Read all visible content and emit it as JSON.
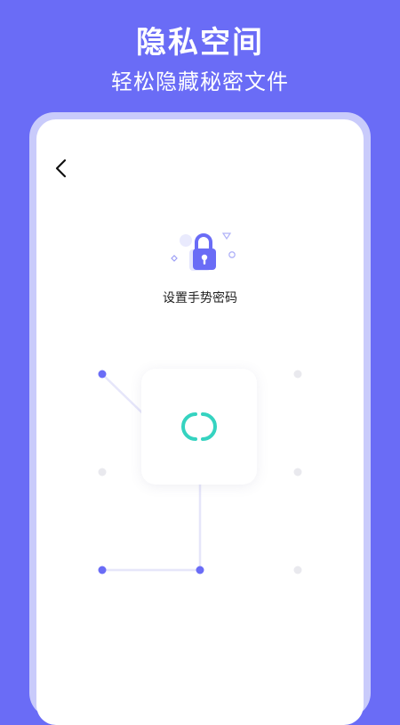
{
  "promo": {
    "title": "隐私空间",
    "subtitle": "轻松隐藏秘密文件"
  },
  "screen": {
    "back_icon": "chevron-left-icon",
    "lock_icon": "padlock-icon",
    "prompt": "设置手势密码",
    "spinner_icon": "loading-spinner-icon"
  },
  "pattern": {
    "grid": "3x3",
    "active_dots": [
      "top-left",
      "bottom-left",
      "bottom-middle"
    ],
    "inactive_dots": [
      "top-right",
      "middle-left",
      "middle-right",
      "bottom-right"
    ]
  },
  "colors": {
    "background": "#6a6cf6",
    "frame": "#c9cbfb",
    "accent": "#6a6cf6",
    "spinner": "#35d3c0",
    "inactive_dot": "#e9e9ee",
    "pattern_line": "#e6e6fa"
  }
}
